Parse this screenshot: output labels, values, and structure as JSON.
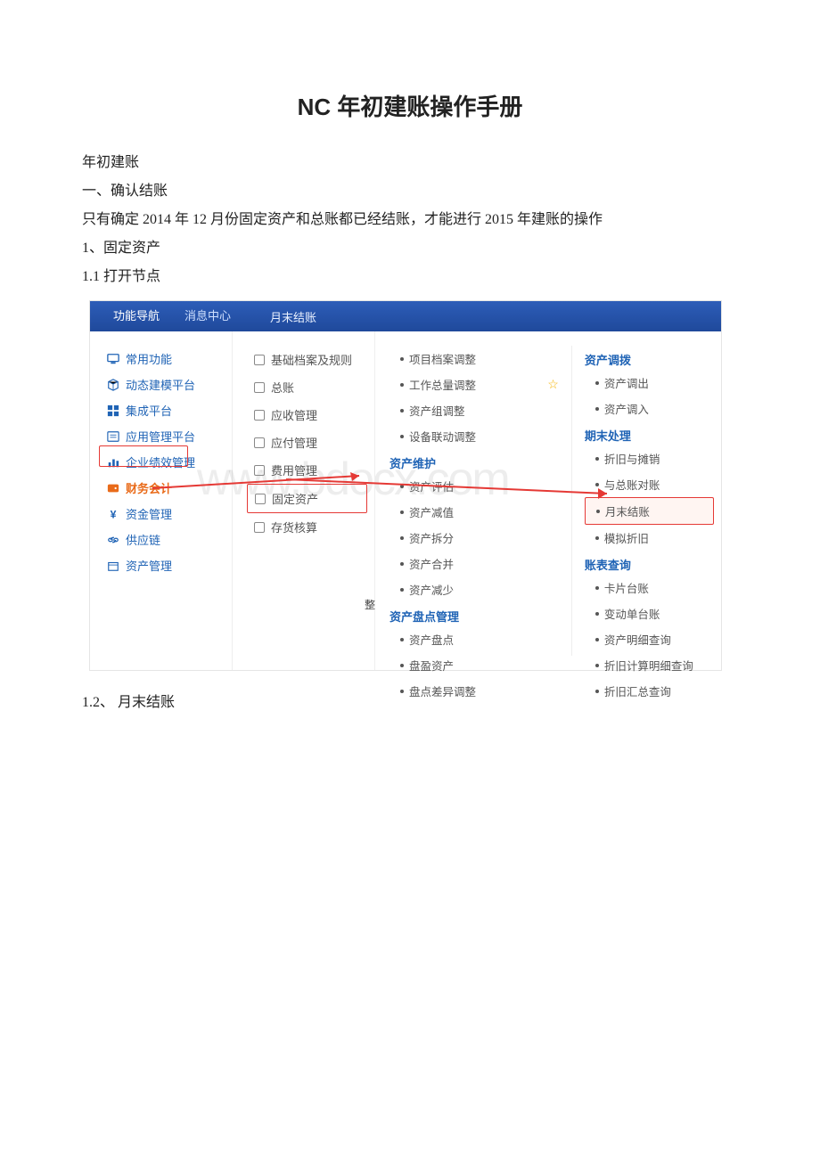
{
  "title": "NC 年初建账操作手册",
  "p1": "年初建账",
  "p2": "一、确认结账",
  "p3": "只有确定 2014 年 12 月份固定资产和总账都已经结账，才能进行 2015 年建账的操作",
  "p4": "1、固定资产",
  "p5": "1.1 打开节点",
  "p6": "1.2、 月末结账",
  "topbar": {
    "tab1": "功能导航",
    "tab2": "消息中心",
    "title": "月末结账"
  },
  "sidebar": {
    "items": [
      {
        "label": "常用功能",
        "icon": "monitor"
      },
      {
        "label": "动态建模平台",
        "icon": "cube"
      },
      {
        "label": "集成平台",
        "icon": "blocks"
      },
      {
        "label": "应用管理平台",
        "icon": "list"
      },
      {
        "label": "企业绩效管理",
        "icon": "chart"
      },
      {
        "label": "财务会计",
        "icon": "wallet",
        "active": true
      },
      {
        "label": "资金管理",
        "icon": "yen"
      },
      {
        "label": "供应链",
        "icon": "link"
      },
      {
        "label": "资产管理",
        "icon": "box"
      }
    ]
  },
  "col2": {
    "items": [
      {
        "label": "基础档案及规则"
      },
      {
        "label": "总账"
      },
      {
        "label": "应收管理"
      },
      {
        "label": "应付管理"
      },
      {
        "label": "费用管理"
      },
      {
        "label": "固定资产",
        "hl": true
      },
      {
        "label": "存货核算"
      }
    ]
  },
  "col3a": {
    "rows": [
      {
        "label": "项目档案调整",
        "type": "link"
      },
      {
        "label": "工作总量调整",
        "type": "link",
        "star": true
      },
      {
        "label": "资产组调整",
        "type": "link"
      },
      {
        "label": "设备联动调整",
        "type": "link"
      },
      {
        "label": "资产维护",
        "type": "hdr"
      },
      {
        "label": "资产评估",
        "type": "link"
      },
      {
        "label": "资产减值",
        "type": "link"
      },
      {
        "label": "资产拆分",
        "type": "link"
      },
      {
        "label": "资产合并",
        "type": "link"
      },
      {
        "label": "资产减少",
        "type": "link"
      },
      {
        "label": "资产盘点管理",
        "type": "hdr"
      },
      {
        "label": "资产盘点",
        "type": "link"
      },
      {
        "label": "盘盈资产",
        "type": "link"
      },
      {
        "label": "盘点差异调整",
        "type": "link"
      }
    ]
  },
  "col3b": {
    "rows": [
      {
        "label": "资产调拨",
        "type": "hdr"
      },
      {
        "label": "资产调出",
        "type": "link"
      },
      {
        "label": "资产调入",
        "type": "link"
      },
      {
        "label": "期末处理",
        "type": "hdr"
      },
      {
        "label": "折旧与摊销",
        "type": "link"
      },
      {
        "label": "与总账对账",
        "type": "link"
      },
      {
        "label": "月末结账",
        "type": "link",
        "hl": true
      },
      {
        "label": "模拟折旧",
        "type": "link"
      },
      {
        "label": "账表查询",
        "type": "hdr"
      },
      {
        "label": "卡片台账",
        "type": "link"
      },
      {
        "label": "变动单台账",
        "type": "link"
      },
      {
        "label": "资产明细查询",
        "type": "link"
      },
      {
        "label": "折旧计算明细查询",
        "type": "link"
      },
      {
        "label": "折旧汇总查询",
        "type": "link"
      }
    ]
  },
  "dangle": "整",
  "watermark": "www.bdocx.com"
}
